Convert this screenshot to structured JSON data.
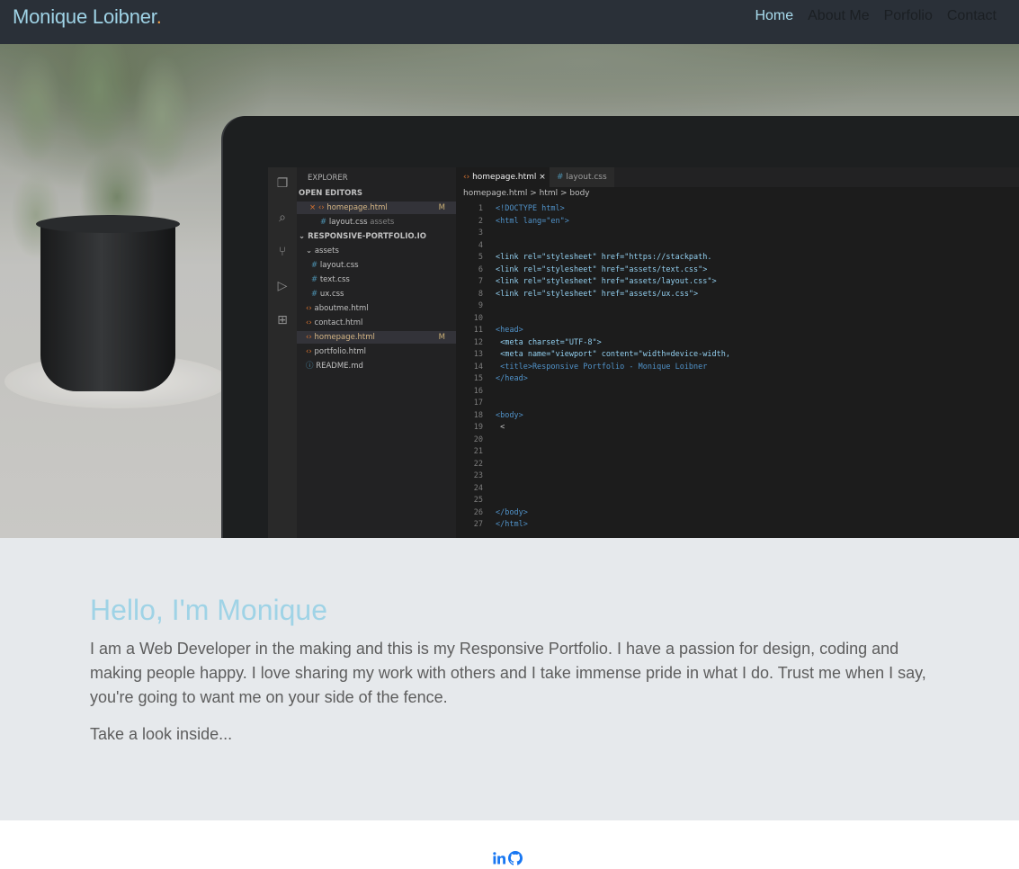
{
  "nav": {
    "brand": "Monique Loibner",
    "brand_dot": ".",
    "links": [
      {
        "label": "Home",
        "active": true
      },
      {
        "label": "About Me",
        "active": false
      },
      {
        "label": "Porfolio",
        "active": false
      },
      {
        "label": "Contact",
        "active": false
      }
    ]
  },
  "hero": {
    "image_desc": "laptop-code-editor-with-plant",
    "editor": {
      "explorer_title": "EXPLORER",
      "open_editors": "OPEN EDITORS",
      "open_file_1": "homepage.html",
      "open_file_2": "layout.css",
      "open_file_2_suffix": "assets",
      "project": "RESPONSIVE-PORTFOLIO.IO",
      "folder": "assets",
      "files": [
        "layout.css",
        "text.css",
        "ux.css",
        "aboutme.html",
        "contact.html",
        "homepage.html",
        "portfolio.html",
        "README.md"
      ],
      "modified_mark": "M",
      "tab_1": "homepage.html",
      "tab_2": "layout.css",
      "breadcrumb": "homepage.html > html > body",
      "code": [
        "<!DOCTYPE html>",
        "<html lang=\"en\">",
        "",
        "",
        "<link rel=\"stylesheet\" href=\"https://stackpath.",
        "<link rel=\"stylesheet\" href=\"assets/text.css\">",
        "<link rel=\"stylesheet\" href=\"assets/layout.css\">",
        "<link rel=\"stylesheet\" href=\"assets/ux.css\">",
        "",
        "",
        "<head>",
        "    <meta charset=\"UTF-8\">",
        "    <meta name=\"viewport\" content=\"width=device-width,",
        "    <title>Responsive Portfolio - Monique Loibner",
        "</head>",
        "",
        "",
        "<body>",
        "    <",
        "",
        "",
        "",
        "",
        "",
        "",
        "</body>",
        "</html>"
      ]
    }
  },
  "intro": {
    "heading": "Hello, I'm Monique",
    "paragraph": "I am a Web Developer in the making and this is my Responsive Portfolio. I have a passion for design, coding and making people happy. I love sharing my work with others and I take immense pride in what I do. Trust me when I say, you're going to want me on your side of the fence.",
    "cta": "Take a look inside..."
  },
  "footer": {
    "icons": [
      "linkedin-icon",
      "github-icon"
    ]
  },
  "colors": {
    "navbar_bg": "#2a3038",
    "accent": "#9fd3e6",
    "intro_bg": "#e6e9ec",
    "social_blue": "#1877f2"
  }
}
